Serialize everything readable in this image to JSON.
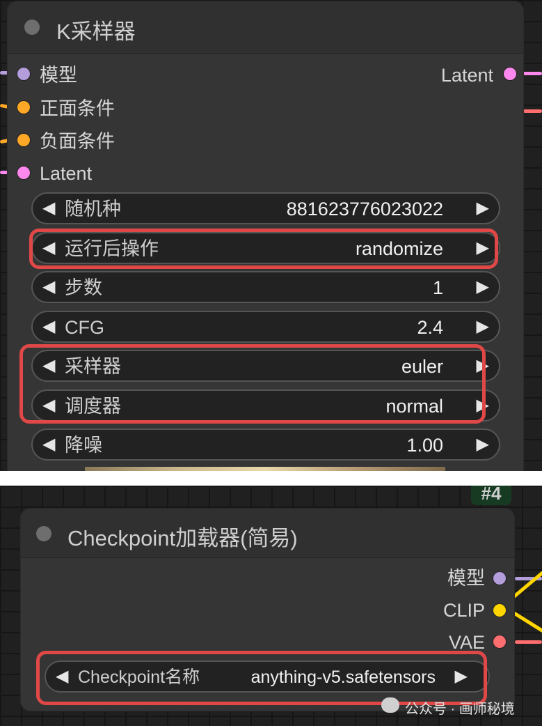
{
  "ksampler": {
    "title": "K采样器",
    "inputs": [
      {
        "label": "模型",
        "color": "#b39ddb"
      },
      {
        "label": "正面条件",
        "color": "#ffa726"
      },
      {
        "label": "负面条件",
        "color": "#ffa726"
      },
      {
        "label": "Latent",
        "color": "#ff88ee"
      }
    ],
    "output": {
      "label": "Latent",
      "color": "#ff88ee"
    },
    "widgets": [
      {
        "label": "随机种",
        "value": "881623776023022",
        "highlighted": false
      },
      {
        "label": "运行后操作",
        "value": "randomize",
        "highlighted": true
      },
      {
        "label": "步数",
        "value": "1",
        "highlighted": false
      },
      {
        "label": "CFG",
        "value": "2.4",
        "highlighted": false
      },
      {
        "label": "采样器",
        "value": "euler",
        "highlighted": true
      },
      {
        "label": "调度器",
        "value": "normal",
        "highlighted": true
      },
      {
        "label": "降噪",
        "value": "1.00",
        "highlighted": false
      }
    ]
  },
  "checkpoint_loader": {
    "badge": "#4",
    "title": "Checkpoint加载器(简易)",
    "outputs": [
      {
        "label": "模型",
        "color": "#b39ddb"
      },
      {
        "label": "CLIP",
        "color": "#ffd500"
      },
      {
        "label": "VAE",
        "color": "#ff6e6e"
      }
    ],
    "widget": {
      "label": "Checkpoint名称",
      "value": "anything-v5.safetensors",
      "highlighted": true
    }
  },
  "controls": {
    "decrement_glyph": "◀",
    "increment_glyph": "▶"
  },
  "watermark": "公众号 · 画师秘境"
}
